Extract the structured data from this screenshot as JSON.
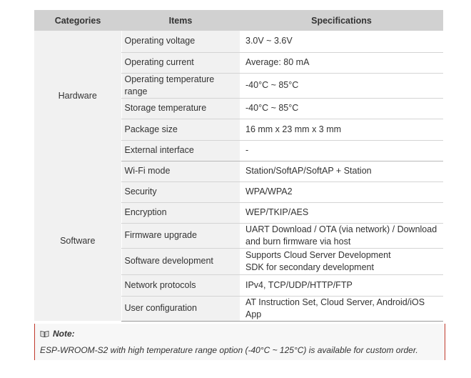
{
  "table": {
    "headers": [
      "Categories",
      "Items",
      "Specifications"
    ],
    "groups": [
      {
        "category": "Hardware",
        "rows": [
          {
            "item": "Operating voltage",
            "spec": "3.0V ~ 3.6V"
          },
          {
            "item": "Operating current",
            "spec": "Average: 80 mA"
          },
          {
            "item": "Operating temperature range",
            "spec": "-40°C ~ 85°C"
          },
          {
            "item": "Storage temperature",
            "spec": "-40°C ~ 85°C"
          },
          {
            "item": "Package size",
            "spec": "16 mm x 23 mm x 3 mm"
          },
          {
            "item": "External interface",
            "spec": "-"
          }
        ]
      },
      {
        "category": "Software",
        "rows": [
          {
            "item": "Wi-Fi mode",
            "spec": "Station/SoftAP/SoftAP + Station"
          },
          {
            "item": "Security",
            "spec": "WPA/WPA2"
          },
          {
            "item": "Encryption",
            "spec": "WEP/TKIP/AES"
          },
          {
            "item": "Firmware upgrade",
            "spec": "UART Download / OTA (via network) / Download and burn firmware via host"
          },
          {
            "item": "Software development",
            "spec": "Supports Cloud Server Development\nSDK for secondary development"
          },
          {
            "item": "Network protocols",
            "spec": "IPv4, TCP/UDP/HTTP/FTP"
          },
          {
            "item": "User configuration",
            "spec": "AT Instruction Set, Cloud Server, Android/iOS App"
          }
        ]
      }
    ]
  },
  "note": {
    "title": "Note:",
    "icon": "book-icon",
    "text": "ESP-WROOM-S2 with high temperature range option (-40°C ~ 125°C) is available for custom order.",
    "accent_color": "#c0392b"
  }
}
